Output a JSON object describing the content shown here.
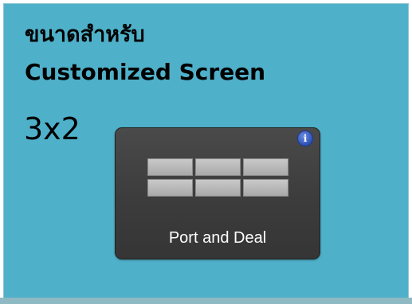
{
  "heading": {
    "thai_title": "ขนาดสำหรับ",
    "english_title": "Customized Screen",
    "size_label": "3x2"
  },
  "tile": {
    "label": "Port and Deal",
    "info_icon": "info-icon",
    "info_glyph": "i",
    "grid_icon": "grid-layout-icon"
  },
  "colors": {
    "background": "#4fb0c9",
    "tile": "#3c3c3c",
    "info_badge": "#2c4fb6"
  }
}
